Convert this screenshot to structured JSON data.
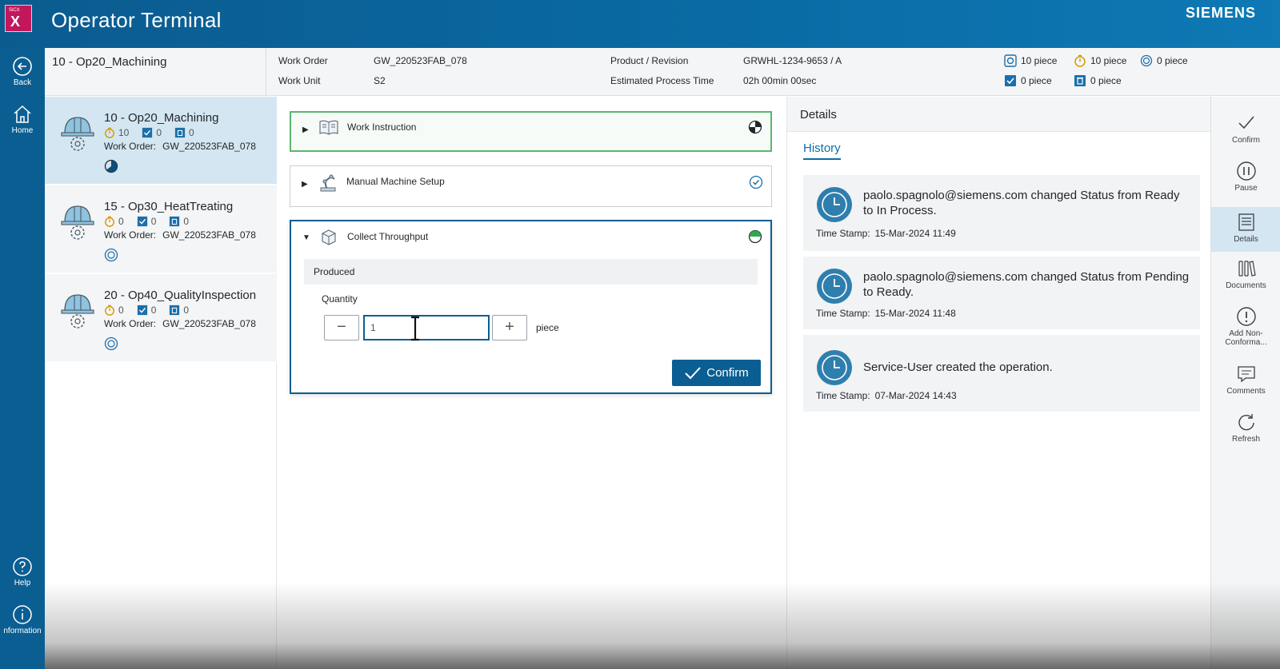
{
  "app": {
    "logo_small": "SiCX",
    "logo_x": "X",
    "title": "Operator Terminal",
    "brand": "SIEMENS"
  },
  "nav": {
    "back": "Back",
    "home": "Home",
    "help": "Help",
    "information": "nformation"
  },
  "header": {
    "operation": "10 - Op20_Machining",
    "work_order_label": "Work Order",
    "work_order_value": "GW_220523FAB_078",
    "work_unit_label": "Work Unit",
    "work_unit_value": "S2",
    "product_label": "Product / Revision",
    "product_value": "GRWHL-1234-9653 / A",
    "est_time_label": "Estimated Process Time",
    "est_time_value": "02h 00min 00sec",
    "stats": {
      "planned": "10 piece",
      "produced": "10 piece",
      "pending": "0 piece",
      "good": "0 piece",
      "scrap": "0 piece"
    }
  },
  "operations": [
    {
      "name": "10 - Op20_Machining",
      "timer": "10",
      "good": "0",
      "scrap": "0",
      "wo_label": "Work Order:",
      "wo_value": "GW_220523FAB_078"
    },
    {
      "name": "15 - Op30_HeatTreating",
      "timer": "0",
      "good": "0",
      "scrap": "0",
      "wo_label": "Work Order:",
      "wo_value": "GW_220523FAB_078"
    },
    {
      "name": "20 - Op40_QualityInspection",
      "timer": "0",
      "good": "0",
      "scrap": "0",
      "wo_label": "Work Order:",
      "wo_value": "GW_220523FAB_078"
    }
  ],
  "steps": {
    "work_instruction": "Work Instruction",
    "manual_setup": "Manual Machine Setup",
    "collect_throughput": "Collect Throughput",
    "produced": "Produced",
    "quantity_label": "Quantity",
    "quantity_value": "1",
    "unit": "piece",
    "minus": "−",
    "plus": "+",
    "confirm": "Confirm"
  },
  "details": {
    "title": "Details",
    "tab": "History",
    "history": [
      {
        "text": "paolo.spagnolo@siemens.com changed Status from Ready to In Process.",
        "ts_label": "Time Stamp:",
        "ts_value": "15-Mar-2024 11:49"
      },
      {
        "text": "paolo.spagnolo@siemens.com changed Status from Pending to Ready.",
        "ts_label": "Time Stamp:",
        "ts_value": "15-Mar-2024 11:48"
      },
      {
        "text": "Service-User created the operation.",
        "ts_label": "Time Stamp:",
        "ts_value": "07-Mar-2024 14:43"
      }
    ]
  },
  "actions": {
    "confirm": "Confirm",
    "pause": "Pause",
    "details": "Details",
    "documents": "Documents",
    "add_nc_1": "Add Non-",
    "add_nc_2": "Conforma...",
    "comments": "Comments",
    "refresh": "Refresh"
  },
  "colors": {
    "primary": "#0b5e92",
    "active_bg": "#d4e6f1",
    "success": "#5bb56f",
    "accent_tab": "#0b6ea8"
  }
}
